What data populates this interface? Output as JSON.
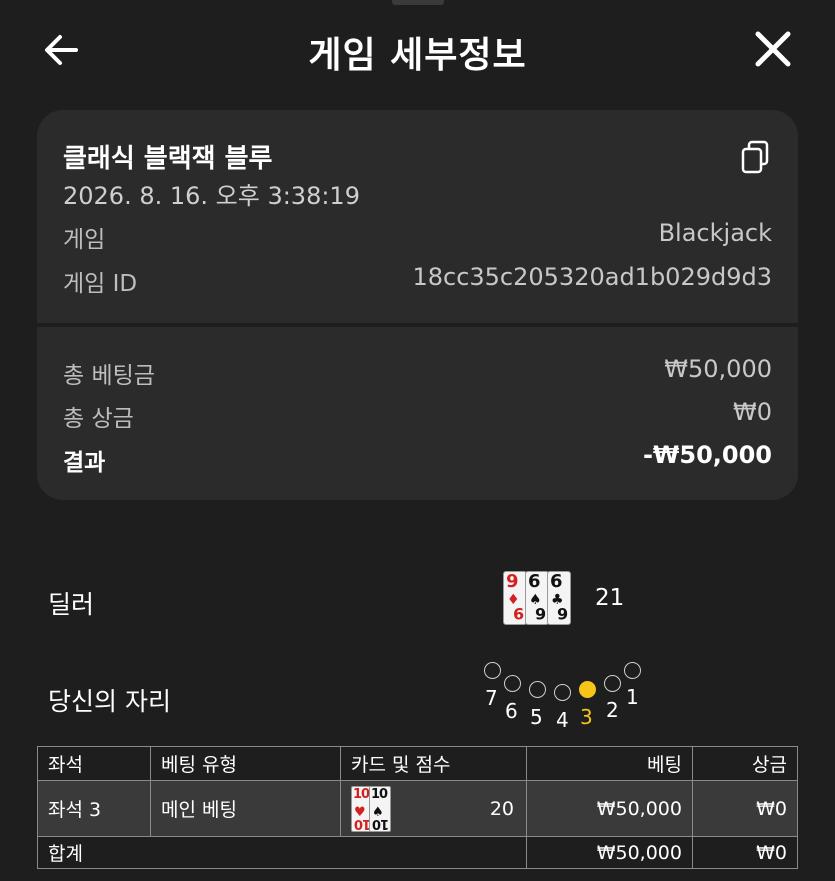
{
  "header": {
    "title": "게임 세부정보",
    "back_icon": "arrow-left-icon",
    "close_icon": "close-icon"
  },
  "summary": {
    "game_name": "클래식 블랙잭 블루",
    "datetime": "2026. 8. 16. 오후 3:38:19",
    "copy_icon": "copy-icon",
    "game_label": "게임",
    "game_value": "Blackjack",
    "game_id_label": "게임 ID",
    "game_id_value": "18cc35c205320ad1b029d9d3",
    "total_bet_label": "총 베팅금",
    "total_bet_value": "₩50,000",
    "total_prize_label": "총 상금",
    "total_prize_value": "₩0",
    "result_label": "결과",
    "result_value": "-₩50,000"
  },
  "dealer": {
    "label": "딜러",
    "cards": [
      {
        "rank": "9",
        "suit": "♦",
        "color": "#d32020"
      },
      {
        "rank": "6",
        "suit": "♠",
        "color": "#111111"
      },
      {
        "rank": "6",
        "suit": "♣",
        "color": "#111111"
      }
    ],
    "total": "21"
  },
  "seats": {
    "label": "당신의 자리",
    "numbers": [
      "7",
      "6",
      "5",
      "4",
      "3",
      "2",
      "1"
    ],
    "active_seat": "3",
    "active_color": "#f5c518"
  },
  "table": {
    "headers": [
      "좌석",
      "베팅 유형",
      "카드 및 점수",
      "베팅",
      "상금"
    ],
    "row": {
      "seat": "좌석 3",
      "bet_type": "메인 베팅",
      "cards": [
        {
          "rank": "10",
          "suit": "♥",
          "color": "#d32020"
        },
        {
          "rank": "10",
          "suit": "♠",
          "color": "#111111"
        }
      ],
      "score": "20",
      "bet": "₩50,000",
      "prize": "₩0"
    },
    "total": {
      "label": "합계",
      "bet": "₩50,000",
      "prize": "₩0"
    }
  }
}
